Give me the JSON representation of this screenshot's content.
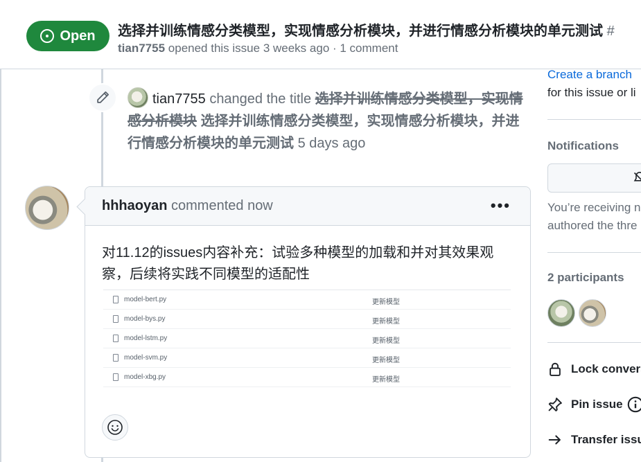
{
  "header": {
    "state": "Open",
    "title": "选择并训练情感分类模型，实现情感分析模块，并进行情感分析模块的单元测试",
    "title_number_fragment": "#",
    "author": "tian7755",
    "meta_text": "opened this issue 3 weeks ago · 1 comment"
  },
  "timeline_event": {
    "actor": "tian7755",
    "action": "changed the title",
    "old_title": "选择并训练情感分类模型，实现情感分析模块",
    "new_title": "选择并训练情感分类模型，实现情感分析模块，并进行情感分析模块的单元测试",
    "time": "5 days ago"
  },
  "comment": {
    "author": "hhhaoyan",
    "action": "commented now",
    "body": "对11.12的issues内容补充：试验多种模型的加载和并对其效果观察，后续将实践不同模型的适配性",
    "files": [
      {
        "name": "model-bert.py",
        "message": "更新模型"
      },
      {
        "name": "model-bys.py",
        "message": "更新模型"
      },
      {
        "name": "model-lstm.py",
        "message": "更新模型"
      },
      {
        "name": "model-svm.py",
        "message": "更新模型"
      },
      {
        "name": "model-xbg.py",
        "message": "更新模型"
      }
    ]
  },
  "sidebar": {
    "create_branch": "Create a branch",
    "create_branch_sub": "for this issue or li",
    "notifications_heading": "Notifications",
    "notifications_text_1": "You’re receiving n",
    "notifications_text_2": "authored the thre",
    "participants_heading": "2 participants",
    "lock": "Lock convers",
    "pin": "Pin issue",
    "transfer": "Transfer issu"
  },
  "colors": {
    "open_green": "#1f883d",
    "link_blue": "#0969da",
    "muted": "#656d76"
  }
}
